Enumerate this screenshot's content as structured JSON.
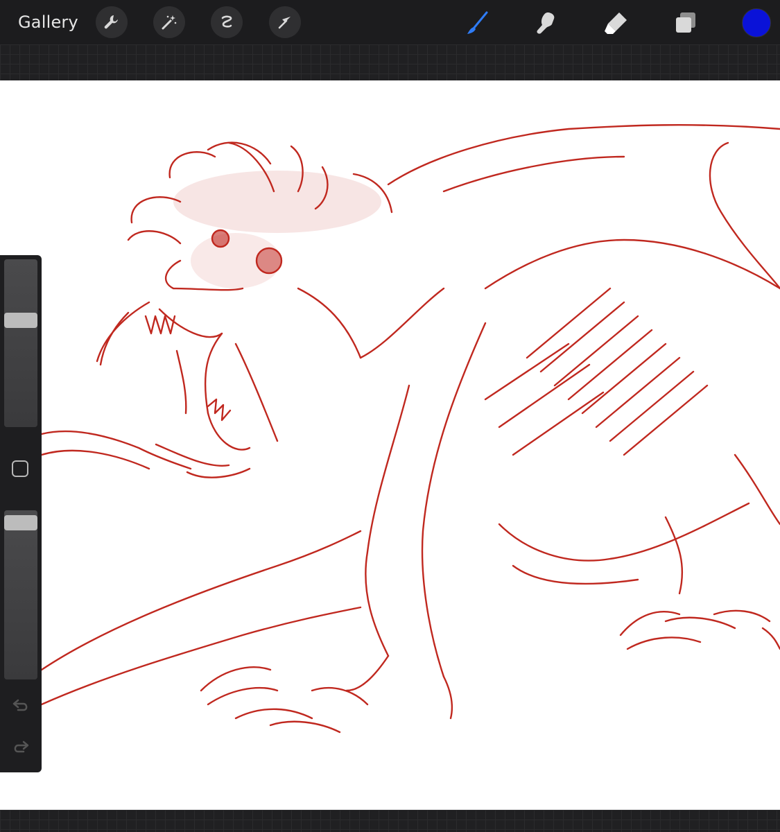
{
  "toolbar": {
    "gallery_label": "Gallery",
    "left_tools": [
      "wrench-icon",
      "magic-wand-icon",
      "selection-icon",
      "transform-arrow-icon"
    ],
    "right_tools": [
      "brush-icon",
      "smudge-icon",
      "eraser-icon",
      "layers-icon"
    ],
    "active_tool": "brush-icon",
    "active_tool_color": "#2f7cf6",
    "current_color": "#0a12d8"
  },
  "canvas": {
    "background": "#ffffff",
    "stroke_color": "#c0281f",
    "subject": "sketch-creature"
  },
  "sidebar": {
    "brush_size_level": 0.65,
    "opacity_level": 0.97,
    "controls": [
      "brush-size-slider",
      "modify-button",
      "opacity-slider",
      "undo-icon",
      "redo-icon"
    ]
  }
}
